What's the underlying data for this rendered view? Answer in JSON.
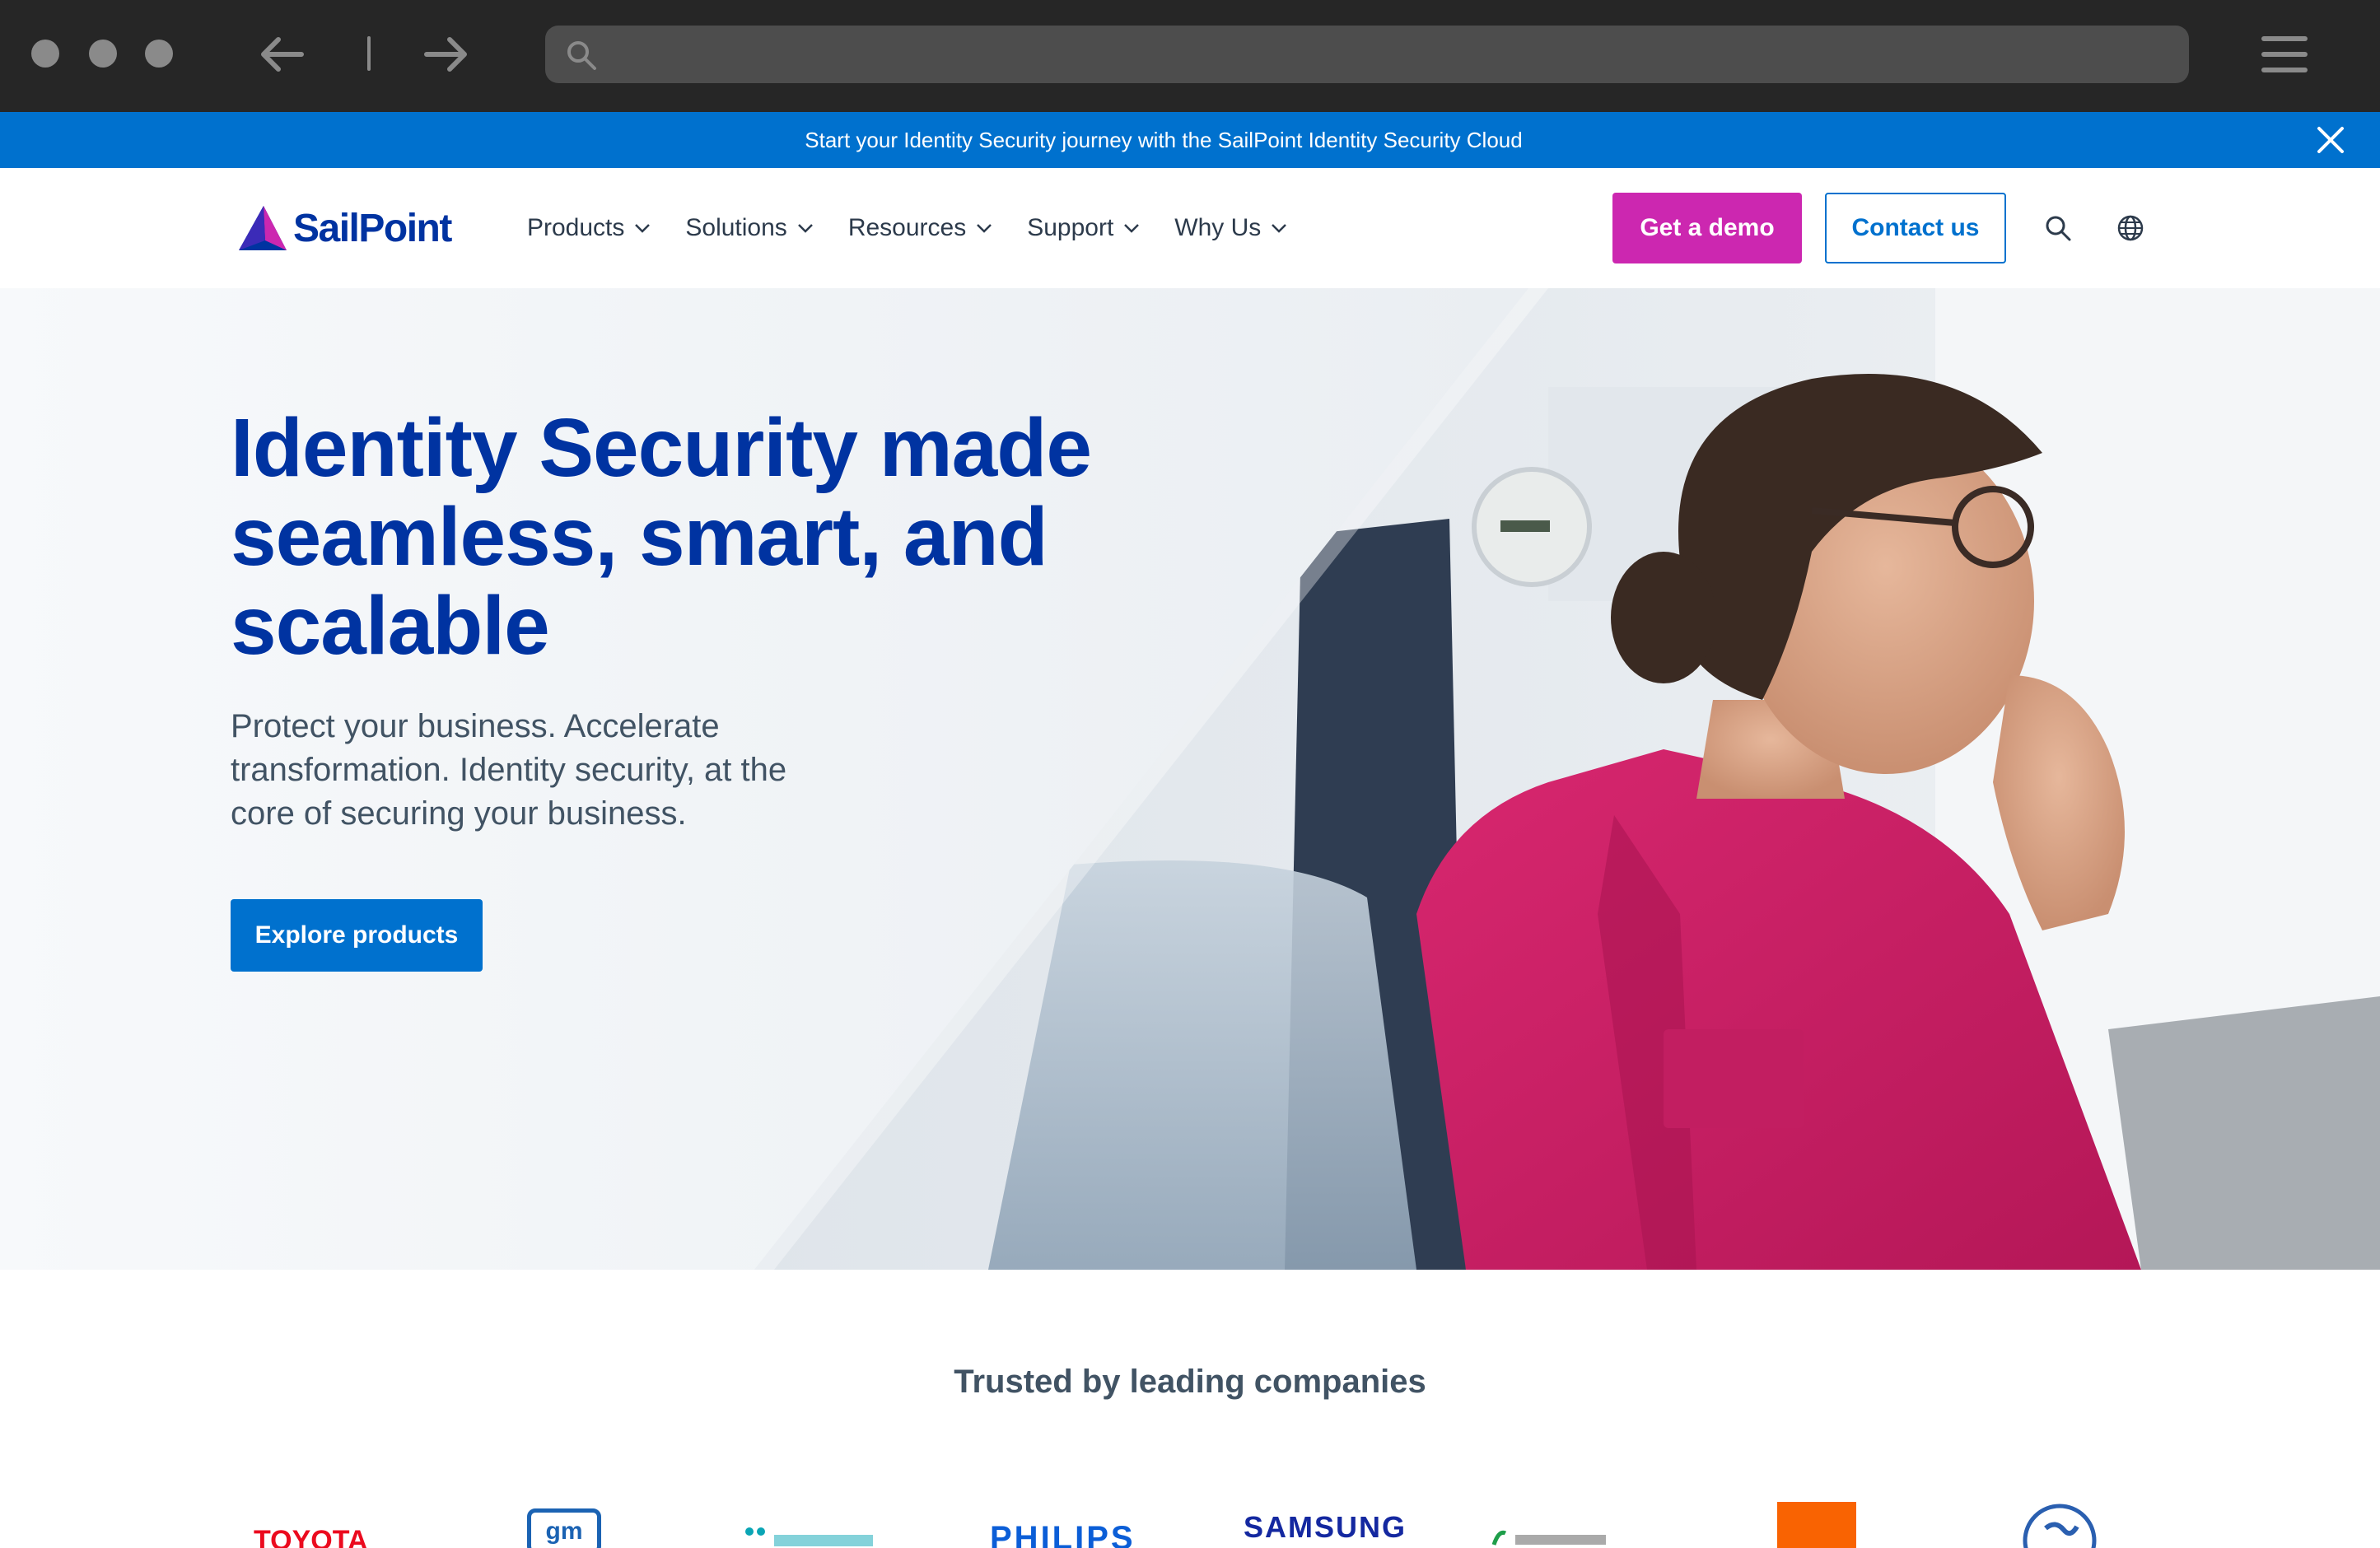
{
  "browser": {
    "back_icon": "arrow-left-icon",
    "forward_icon": "arrow-right-icon",
    "search_icon": "search-icon",
    "menu_icon": "hamburger-icon"
  },
  "announcement": {
    "text": "Start your Identity Security journey with the SailPoint Identity Security Cloud",
    "close_icon": "close-icon",
    "color": "#0071ce"
  },
  "header": {
    "logo_text": "SailPoint",
    "nav": [
      {
        "label": "Products"
      },
      {
        "label": "Solutions"
      },
      {
        "label": "Resources"
      },
      {
        "label": "Support"
      },
      {
        "label": "Why Us"
      }
    ],
    "demo_label": "Get a demo",
    "contact_label": "Contact us",
    "search_icon": "search-icon",
    "language_icon": "globe-icon"
  },
  "hero": {
    "title": "Identity Security made seamless, smart, and scalable",
    "subtitle": "Protect your business. Accelerate transformation. Identity security, at the core of securing your business.",
    "cta_label": "Explore products"
  },
  "trusted": {
    "title": "Trusted by leading companies",
    "logos": [
      "TOYOTA",
      "gm",
      "",
      "PHILIPS",
      "SAMSUNG",
      "",
      "",
      ""
    ]
  },
  "colors": {
    "brand_blue": "#0033a1",
    "primary": "#0071ce",
    "demo_magenta": "#cc27b0",
    "body_text": "#415364"
  }
}
